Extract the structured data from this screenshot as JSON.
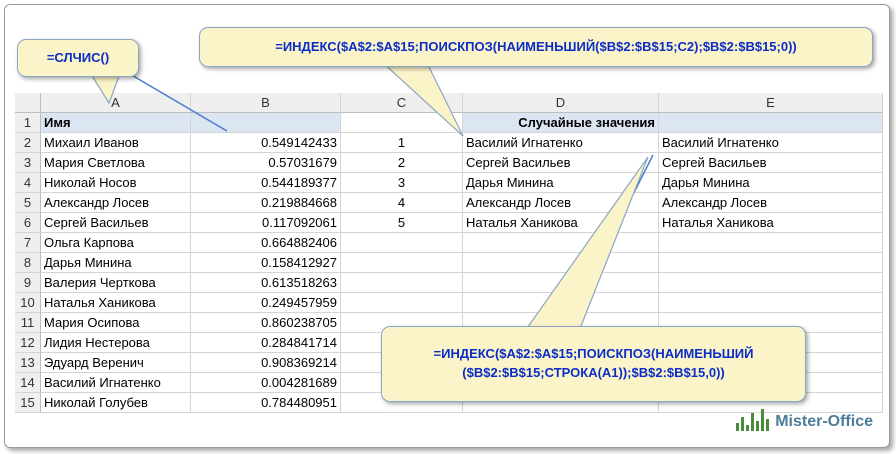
{
  "columns": [
    "A",
    "B",
    "C",
    "D",
    "E"
  ],
  "row_numbers": [
    "1",
    "2",
    "3",
    "4",
    "5",
    "6",
    "7",
    "8",
    "9",
    "10",
    "11",
    "12",
    "13",
    "14",
    "15"
  ],
  "header_row": {
    "A": "Имя",
    "B": "",
    "C": "",
    "D": "Случайные значения",
    "E": ""
  },
  "rows": [
    {
      "A": "Михаил Иванов",
      "B": "0.549142433",
      "C": "1",
      "D": "Василий Игнатенко",
      "E": "Василий Игнатенко"
    },
    {
      "A": "Мария Светлова",
      "B": "0.57031679",
      "C": "2",
      "D": "Сергей Васильев",
      "E": "Сергей Васильев"
    },
    {
      "A": "Николай Носов",
      "B": "0.544189377",
      "C": "3",
      "D": "Дарья Минина",
      "E": "Дарья Минина"
    },
    {
      "A": "Александр Лосев",
      "B": "0.219884668",
      "C": "4",
      "D": "Александр Лосев",
      "E": "Александр Лосев"
    },
    {
      "A": "Сергей Васильев",
      "B": "0.117092061",
      "C": "5",
      "D": "Наталья Ханикова",
      "E": "Наталья Ханикова"
    },
    {
      "A": "Ольга Карпова",
      "B": "0.664882406",
      "C": "",
      "D": "",
      "E": ""
    },
    {
      "A": "Дарья Минина",
      "B": "0.158412927",
      "C": "",
      "D": "",
      "E": ""
    },
    {
      "A": "Валерия Черткова",
      "B": "0.613518263",
      "C": "",
      "D": "",
      "E": ""
    },
    {
      "A": "Наталья Ханикова",
      "B": "0.249457959",
      "C": "",
      "D": "",
      "E": ""
    },
    {
      "A": "Мария Осипова",
      "B": "0.860238705",
      "C": "",
      "D": "",
      "E": ""
    },
    {
      "A": "Лидия Нестерова",
      "B": "0.284841714",
      "C": "",
      "D": "",
      "E": ""
    },
    {
      "A": "Эдуард Веренич",
      "B": "0.908369214",
      "C": "",
      "D": "",
      "E": ""
    },
    {
      "A": "Василий Игнатенко",
      "B": "0.004281689",
      "C": "",
      "D": "",
      "E": ""
    },
    {
      "A": "Николай Голубев",
      "B": "0.784480951",
      "C": "",
      "D": "",
      "E": ""
    }
  ],
  "callouts": {
    "rand": "=СЛЧИС()",
    "formula_d": "=ИНДЕКС($A$2:$A$15;ПОИСКПОЗ(НАИМЕНЬШИЙ($B$2:$B$15;C2);$B$2:$B$15;0))",
    "formula_e_line1": "=ИНДЕКС($A$2:$A$15;ПОИСКПОЗ(НАИМЕНЬШИЙ",
    "formula_e_line2": "($B$2:$B$15;СТРОКА(A1));$B$2:$B$15,0))"
  },
  "logo_text": "Mister-Office",
  "colors": {
    "callout_text": "#0a2dc8",
    "callout_fill": "#fcf4c9",
    "header_fill": "#dce6f2",
    "pointer_line": "#4a7fd0"
  }
}
